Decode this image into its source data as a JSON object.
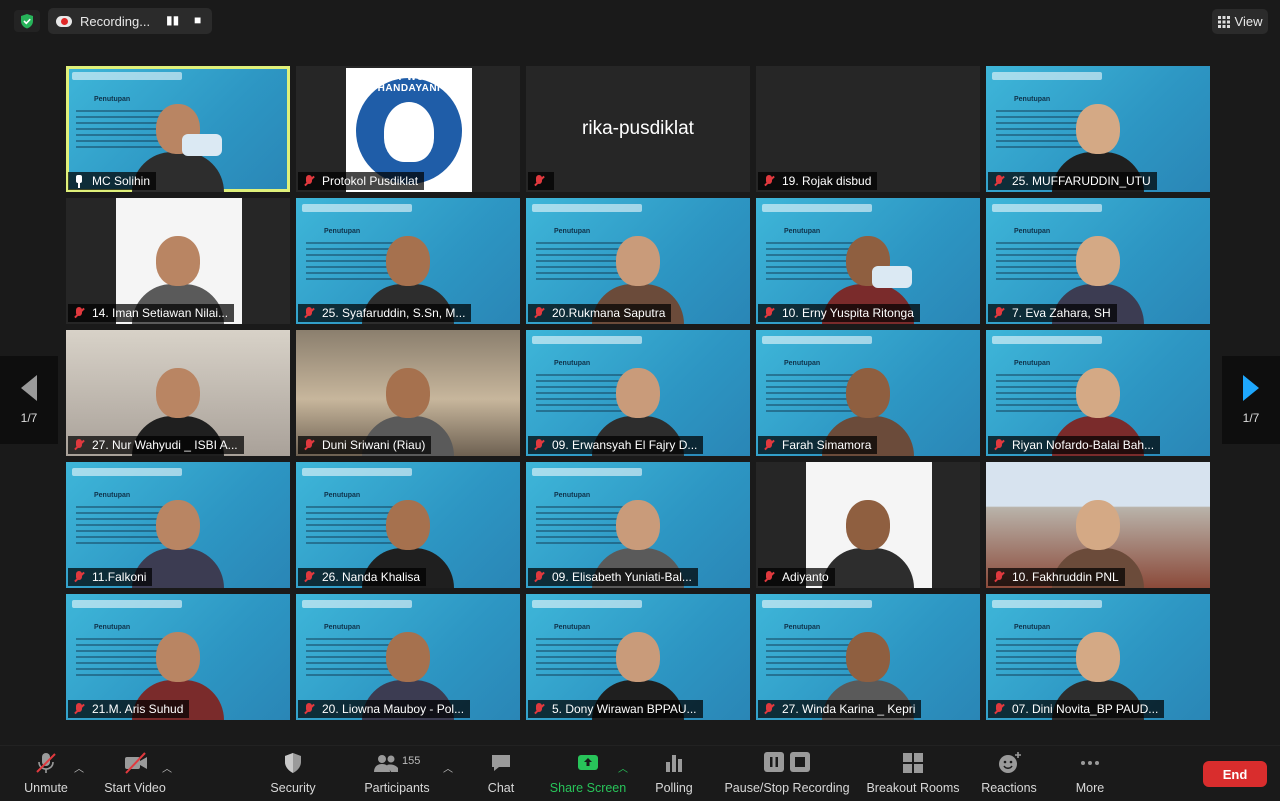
{
  "topbar": {
    "recording_label": "Recording...",
    "view_label": "View"
  },
  "pager": {
    "left": "1/7",
    "right": "1/7"
  },
  "tiles": [
    {
      "name": "MC Solihin",
      "icon": "pin-icon",
      "style": "blue",
      "slide": "Penutupan",
      "active": true
    },
    {
      "name": "Protokol Pusdiklat",
      "icon": "mute-icon",
      "style": "logo",
      "logo_text": "TUT WURI HANDAYANI"
    },
    {
      "name": "",
      "big": "rika-pusdiklat",
      "icon": "mute-icon",
      "style": "dark"
    },
    {
      "name": "19. Rojak disbud",
      "icon": "mute-icon",
      "style": "dark"
    },
    {
      "name": "25. MUFFARUDDIN_UTU",
      "icon": "mute-icon",
      "style": "blue",
      "slide": "Penutupan"
    },
    {
      "name": "14. Iman Setiawan Nilai...",
      "icon": "mute-icon",
      "style": "white"
    },
    {
      "name": "25. Syafaruddin, S.Sn, M...",
      "icon": "mute-icon",
      "style": "blue",
      "slide": "Penutupan"
    },
    {
      "name": "20.Rukmana Saputra",
      "icon": "mute-icon",
      "style": "blue",
      "slide": "Penutupan"
    },
    {
      "name": "10. Erny Yuspita Ritonga",
      "icon": "mute-icon",
      "style": "blue",
      "slide": "Penutupan"
    },
    {
      "name": "7. Eva Zahara, SH",
      "icon": "mute-icon",
      "style": "blue",
      "slide": "Penutupan"
    },
    {
      "name": "27. Nur Wahyudi _ ISBI A...",
      "icon": "mute-icon",
      "style": "wall"
    },
    {
      "name": "Duni Sriwani (Riau)",
      "icon": "mute-icon",
      "style": "room"
    },
    {
      "name": "09. Erwansyah El Fajry D...",
      "icon": "mute-icon",
      "style": "blue",
      "slide": "Penutupan"
    },
    {
      "name": "Farah Simamora",
      "icon": "mute-icon",
      "style": "blue",
      "slide": "Penutupan"
    },
    {
      "name": "Riyan Nofardo-Balai Bah...",
      "icon": "mute-icon",
      "style": "blue",
      "slide": "Penutupan"
    },
    {
      "name": "11.Falkoni",
      "icon": "mute-icon",
      "style": "blue",
      "slide": "Penutupan"
    },
    {
      "name": "26. Nanda Khalisa",
      "icon": "mute-icon",
      "style": "blue",
      "slide": "Penutupan"
    },
    {
      "name": "09. Elisabeth Yuniati-Bal...",
      "icon": "mute-icon",
      "style": "blue",
      "slide": "Penutupan"
    },
    {
      "name": "Adiyanto",
      "icon": "mute-icon",
      "style": "white"
    },
    {
      "name": "10. Fakhruddin PNL",
      "icon": "mute-icon",
      "style": "building"
    },
    {
      "name": "21.M. Aris Suhud",
      "icon": "mute-icon",
      "style": "blue",
      "slide": "Penutupan"
    },
    {
      "name": "20. Liowna Mauboy - Pol...",
      "icon": "mute-icon",
      "style": "blue",
      "slide": "Penutupan"
    },
    {
      "name": "5. Dony Wirawan BPPAU...",
      "icon": "mute-icon",
      "style": "blue",
      "slide": "Penutupan"
    },
    {
      "name": "27. Winda Karina _ Kepri",
      "icon": "mute-icon",
      "style": "blue",
      "slide": "Penutupan"
    },
    {
      "name": "07. Dini Novita_BP PAUD...",
      "icon": "mute-icon",
      "style": "blue",
      "slide": "Penutupan"
    }
  ],
  "toolbar": {
    "unmute": "Unmute",
    "start_video": "Start Video",
    "security": "Security",
    "participants": "Participants",
    "participants_count": "155",
    "chat": "Chat",
    "share_screen": "Share Screen",
    "polling": "Polling",
    "pause_stop_recording": "Pause/Stop Recording",
    "breakout_rooms": "Breakout Rooms",
    "reactions": "Reactions",
    "more": "More",
    "end": "End"
  },
  "colors": {
    "accent_green": "#28c45a",
    "end_red": "#d92d2d",
    "active_speaker": "#dff07a",
    "nav_blue": "#1ea7fd"
  }
}
